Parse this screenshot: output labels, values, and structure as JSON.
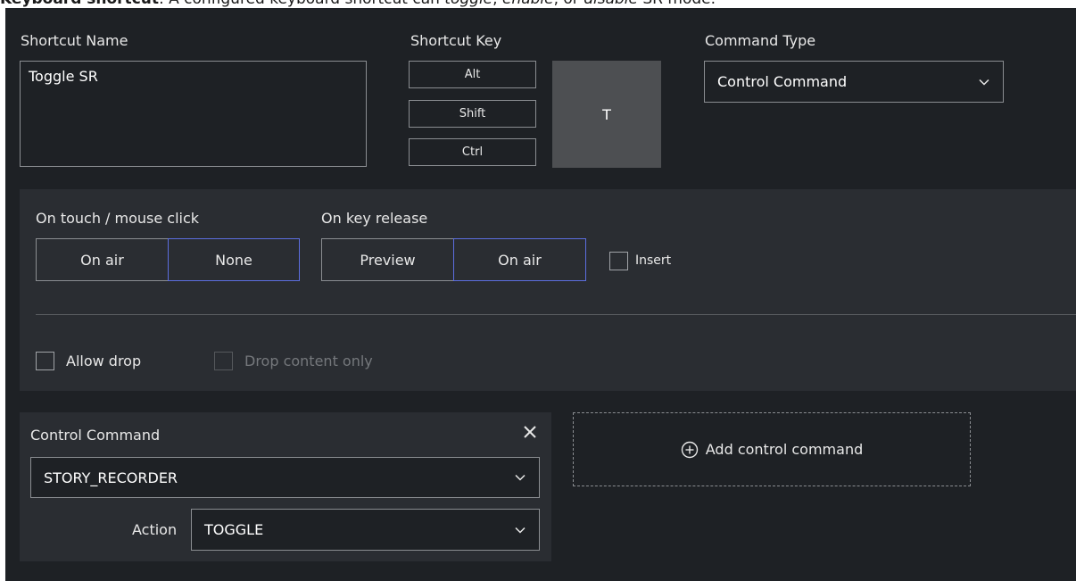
{
  "caption": {
    "lead": "Keyboard shortcut",
    "sep": ": A configured keyboard shortcut can ",
    "w1": "toggle",
    "c1": ", ",
    "w2": "enable",
    "c2": ", or ",
    "w3": "disable",
    "tail": " SR mode."
  },
  "shortcut": {
    "name_label": "Shortcut Name",
    "name_value": "Toggle SR",
    "key_label": "Shortcut Key",
    "modifiers": [
      "Alt",
      "Shift",
      "Ctrl"
    ],
    "key": "T",
    "type_label": "Command Type",
    "type_value": "Control Command"
  },
  "behavior": {
    "touch_label": "On touch / mouse click",
    "touch_options": [
      "On air",
      "None"
    ],
    "touch_selected": "None",
    "release_label": "On key release",
    "release_options": [
      "Preview",
      "On air"
    ],
    "release_selected": "On air",
    "insert_label": "Insert",
    "allow_drop_label": "Allow drop",
    "drop_only_label": "Drop content only"
  },
  "control_command": {
    "title": "Control Command",
    "command_value": "STORY_RECORDER",
    "action_label": "Action",
    "action_value": "TOGGLE",
    "add_label": "Add control command"
  },
  "colors": {
    "background": "#1e2125",
    "panel": "#2a2d32",
    "border": "#8a8d91",
    "accent": "#5c6ee0",
    "key": "#4d4f52"
  }
}
